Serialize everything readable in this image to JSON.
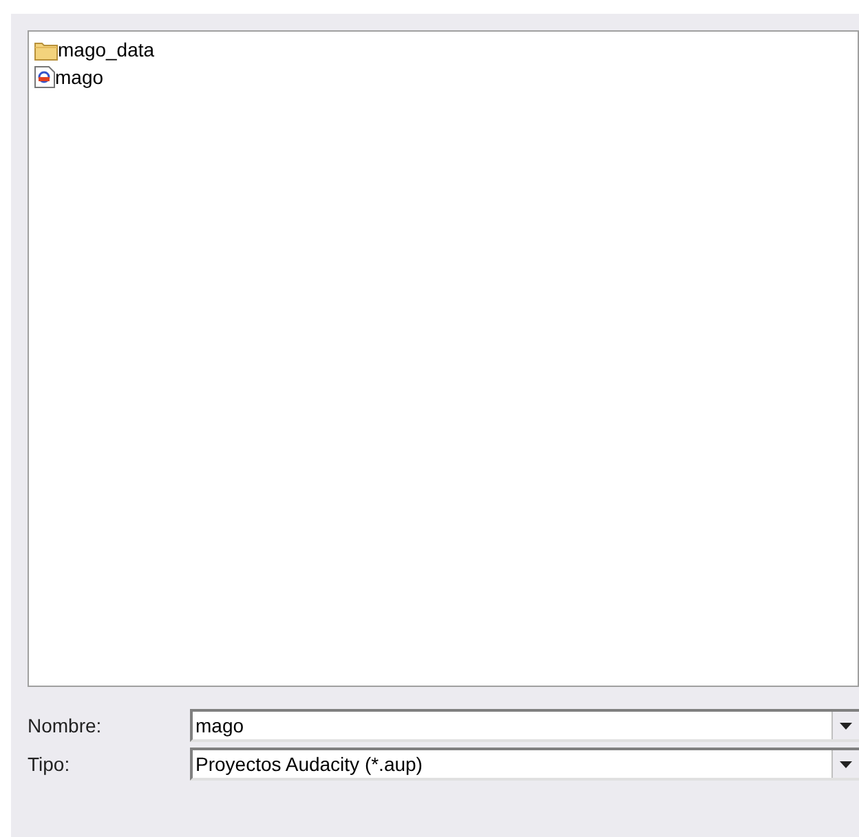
{
  "files": [
    {
      "kind": "folder",
      "name": "mago_data"
    },
    {
      "kind": "project",
      "name": "mago"
    }
  ],
  "fields": [
    {
      "label": "Nombre:",
      "value": "mago"
    },
    {
      "label": "Tipo:",
      "value": "Proyectos Audacity (*.aup)"
    }
  ]
}
